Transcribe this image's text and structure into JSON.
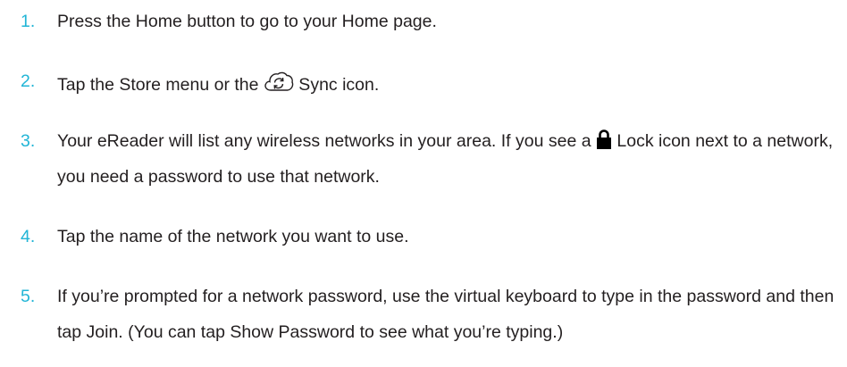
{
  "steps": [
    {
      "number": "1.",
      "parts": [
        "Press the Home button to go to your Home page."
      ]
    },
    {
      "number": "2.",
      "parts": [
        "Tap the Store menu or the ",
        " Sync icon."
      ],
      "icon": "sync-icon"
    },
    {
      "number": "3.",
      "parts": [
        "Your eReader will list any wireless networks in your area. If you see a ",
        " Lock icon next to a network,  you need a password to use that network."
      ],
      "icon": "lock-icon"
    },
    {
      "number": "4.",
      "parts": [
        "Tap the name of the network you want to use."
      ]
    },
    {
      "number": "5.",
      "parts": [
        "If you’re prompted for a network password, use the virtual keyboard to type in the password  and then tap Join.  (You can tap Show Password to see what you’re typing.)"
      ]
    }
  ],
  "colors": {
    "number": "#21b5d6",
    "text": "#231f20"
  }
}
